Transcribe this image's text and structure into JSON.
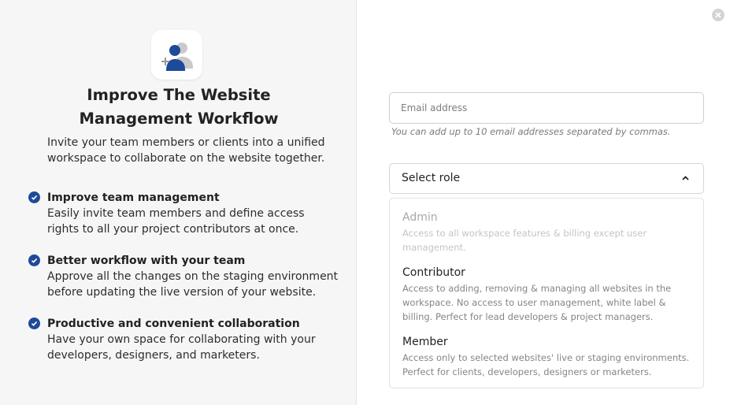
{
  "hero": {
    "title_line1": "Improve The Website",
    "title_line2": "Management Workflow",
    "intro": "Invite your team members or clients into a unified workspace to collaborate on the website together."
  },
  "features": [
    {
      "title": "Improve team management",
      "description": "Easily invite team members and define access rights to all your project contributors at once."
    },
    {
      "title": "Better workflow with your team",
      "description": "Approve all the changes on the staging environment before updating the live version of your website."
    },
    {
      "title": "Productive and convenient collaboration",
      "description": "Have your own space for collaborating with your developers, designers, and marketers."
    }
  ],
  "form": {
    "email_placeholder": "Email address",
    "email_value": "",
    "email_hint": "You can add up to 10 email addresses separated by commas.",
    "role_select_value": "Select role",
    "roles": [
      {
        "name": "Admin",
        "description": "Access to all workspace features & billing except user management.",
        "disabled": true
      },
      {
        "name": "Contributor",
        "description": "Access to adding, removing & managing all websites in the workspace. No access to user management, white label & billing. Perfect for lead developers & project managers.",
        "disabled": false
      },
      {
        "name": "Member",
        "description": "Access only to selected websites' live or staging environments. Perfect for clients, developers, designers or marketers.",
        "disabled": false
      }
    ]
  },
  "icons": {
    "logo": "add-team-members-icon",
    "close": "close-icon",
    "check": "check-circle-icon",
    "chevron": "chevron-up-icon"
  },
  "colors": {
    "accent": "#1e4a9a",
    "left_panel_bg": "#f6f6f6"
  }
}
